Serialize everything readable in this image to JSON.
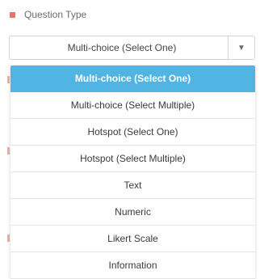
{
  "field": {
    "label": "Question Type",
    "selected_value": "Multi-choice (Select One)",
    "arrow_icon": "▼"
  },
  "dropdown": {
    "options": [
      "Multi-choice (Select One)",
      "Multi-choice (Select Multiple)",
      "Hotspot (Select One)",
      "Hotspot (Select Multiple)",
      "Text",
      "Numeric",
      "Likert Scale",
      "Information"
    ],
    "highlighted_index": 0
  },
  "colors": {
    "accent": "#52b4e3",
    "required_marker": "#e0776a"
  }
}
